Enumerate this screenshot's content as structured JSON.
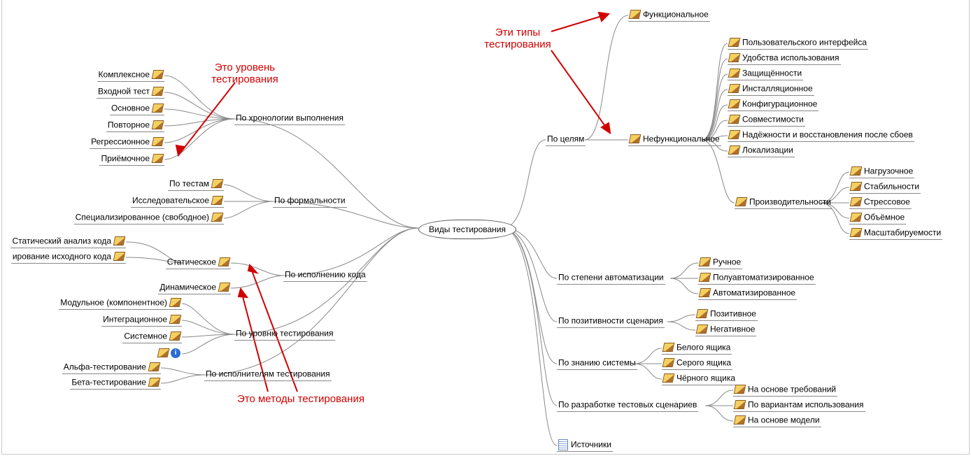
{
  "center": {
    "label": "Виды тестирования"
  },
  "annotations": {
    "level": "Это уровень\nтестирования",
    "types": "Эти типы\nтестирования",
    "methods": "Это методы тестирования"
  },
  "left": {
    "chronology": {
      "label": "По хронологии выполнения",
      "items": [
        "Комплексное",
        "Входной тест",
        "Основное",
        "Повторное",
        "Регрессионное",
        "Приёмочное"
      ]
    },
    "formality": {
      "label": "По формальности",
      "items": [
        "По тестам",
        "Исследовательское",
        "Специализированное (свободное)"
      ]
    },
    "code_exec": {
      "label": "По исполнению кода",
      "static": "Статическое",
      "dynamic": "Динамическое",
      "static_children": [
        "Статический анализ кода",
        "ирование исходного кода"
      ]
    },
    "level": {
      "label": "По уровню тестирования",
      "items": [
        "Модульное (компонентное)",
        "Интеграционное",
        "Системное"
      ]
    },
    "executors": {
      "label": "По исполнителям тестирования",
      "items": [
        "Альфа-тестирование",
        "Бета-тестирование"
      ]
    }
  },
  "right": {
    "goals": {
      "label": "По целям",
      "functional": "Функциональное",
      "nonfunctional": "Нефункциональное",
      "nf_children": [
        "Пользовательского интерфейса",
        "Удобства использования",
        "Защищённости",
        "Инсталляционное",
        "Конфигурационное",
        "Совместимости",
        "Надёжности и восстановления после сбоев",
        "Локализации"
      ],
      "perf": "Производительности",
      "perf_children": [
        "Нагрузочное",
        "Стабильности",
        "Стрессовое",
        "Объёмное",
        "Масштабируемости"
      ]
    },
    "automation": {
      "label": "По степени автоматизации",
      "items": [
        "Ручное",
        "Полуавтоматизированное",
        "Автоматизированное"
      ]
    },
    "positivity": {
      "label": "По позитивности сценария",
      "items": [
        "Позитивное",
        "Негативное"
      ]
    },
    "knowledge": {
      "label": "По знанию системы",
      "items": [
        "Белого ящика",
        "Серого ящика",
        "Чёрного ящика"
      ]
    },
    "scenarios": {
      "label": "По разработке тестовых сценариев",
      "items": [
        "На основе требований",
        "По вариантам использования",
        "На основе модели"
      ]
    },
    "sources": {
      "label": "Источники"
    }
  }
}
